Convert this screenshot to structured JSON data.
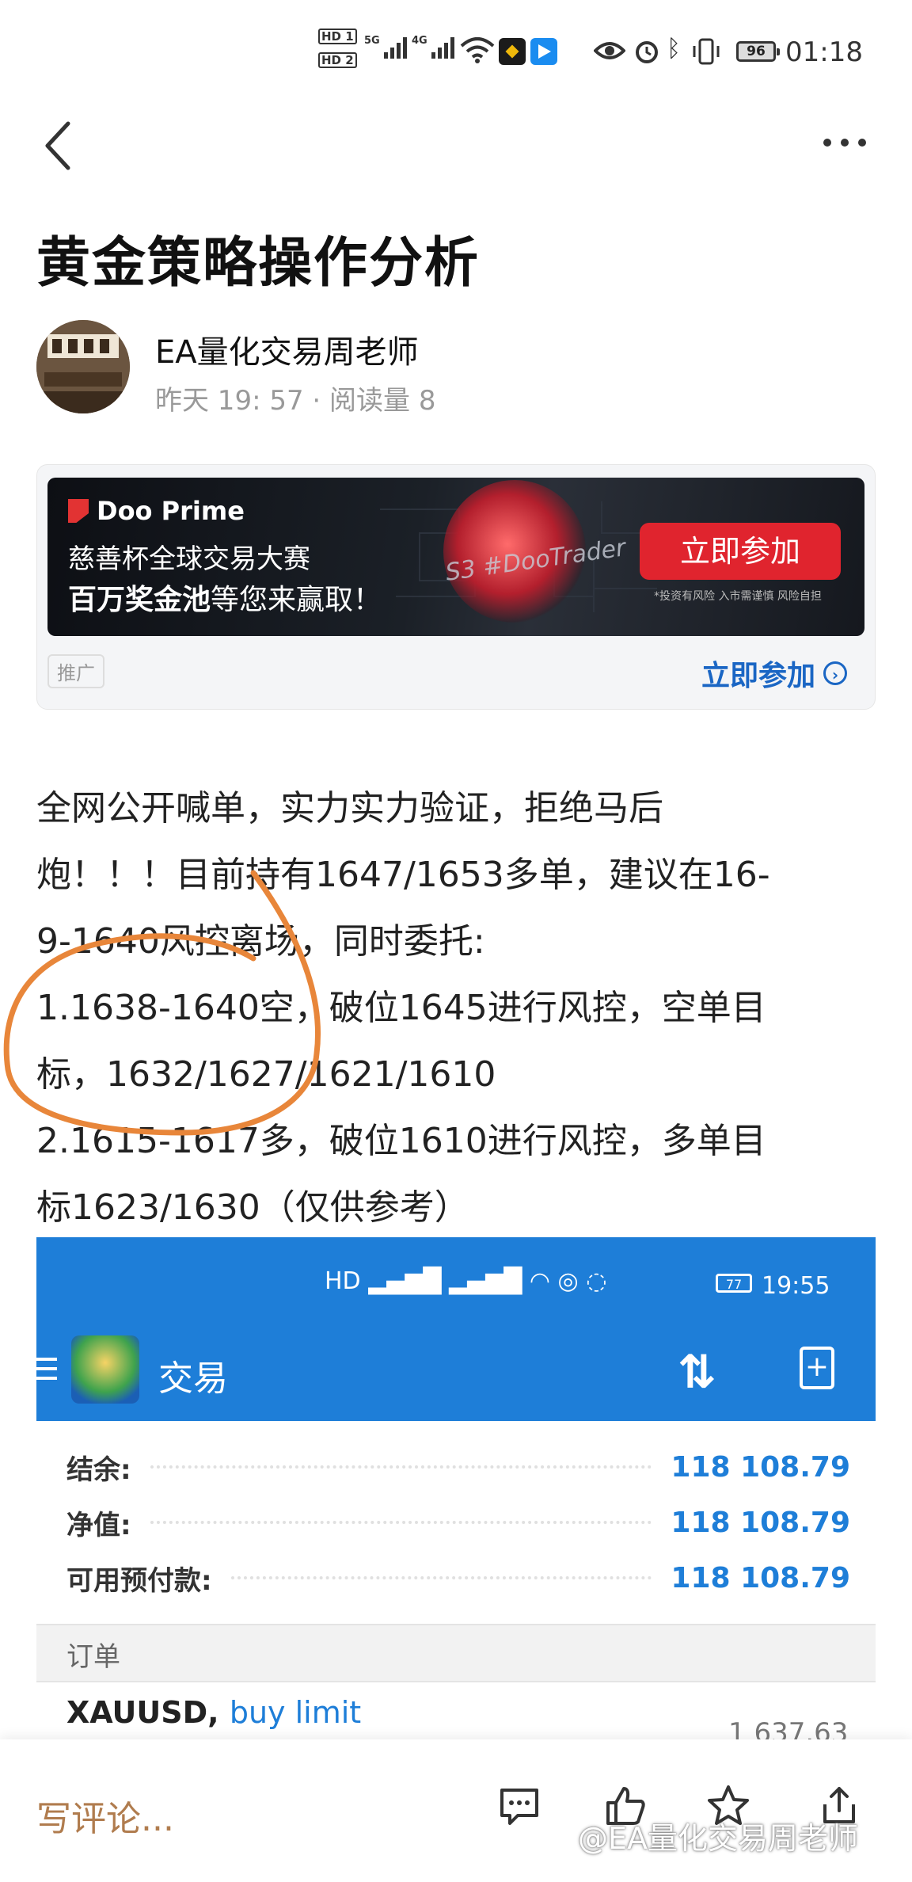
{
  "status_bar": {
    "network": [
      "5G",
      "4G"
    ],
    "battery": "96",
    "time": "01:18"
  },
  "article": {
    "title": "黄金策略操作分析",
    "author": "EA量化交易周老师",
    "meta": "昨天 19: 57 · 阅读量 8",
    "paragraphs": [
      "全网公开喊单，实力实力验证，拒绝马后",
      "炮！！！目前持有1647/1653多单，建议在16-",
      "9-1640风控离场，同时委托:",
      "1.1638-1640空，破位1645进行风控，空单目",
      "标，1632/1627/1621/1610",
      "2.1615-1617多，破位1610进行风控，多单目",
      "标1623/1630（仅供参考）"
    ]
  },
  "ad": {
    "brand": "Doo Prime",
    "line1": "慈善杯全球交易大赛",
    "line2_bold": "百万奖金池",
    "line2_rest": "等您来赢取！",
    "tagline": "S3 #DooTrader",
    "button": "立即参加",
    "warning": "*投资有风险 入市需谨慎 风险自担",
    "tag": "推广",
    "cta": "立即参加"
  },
  "embedded_screenshot": {
    "battery": "77",
    "time": "19:55",
    "header_title": "交易",
    "account": [
      {
        "label": "结余:",
        "value": "118 108.79"
      },
      {
        "label": "净值:",
        "value": "118 108.79"
      },
      {
        "label": "可用预付款:",
        "value": "118 108.79"
      }
    ],
    "orders_header": "订单",
    "order": {
      "symbol": "XAUUSD,",
      "type": "buy limit",
      "price": "1 637.63"
    }
  },
  "bottom_bar": {
    "comment_placeholder": "写评论...",
    "watermark": "@EA量化交易周老师"
  },
  "colors": {
    "accent_blue": "#1e7ed8",
    "ad_red": "#e0242e",
    "annotation_orange": "#e8863a",
    "comment_text": "#b07c4e"
  }
}
